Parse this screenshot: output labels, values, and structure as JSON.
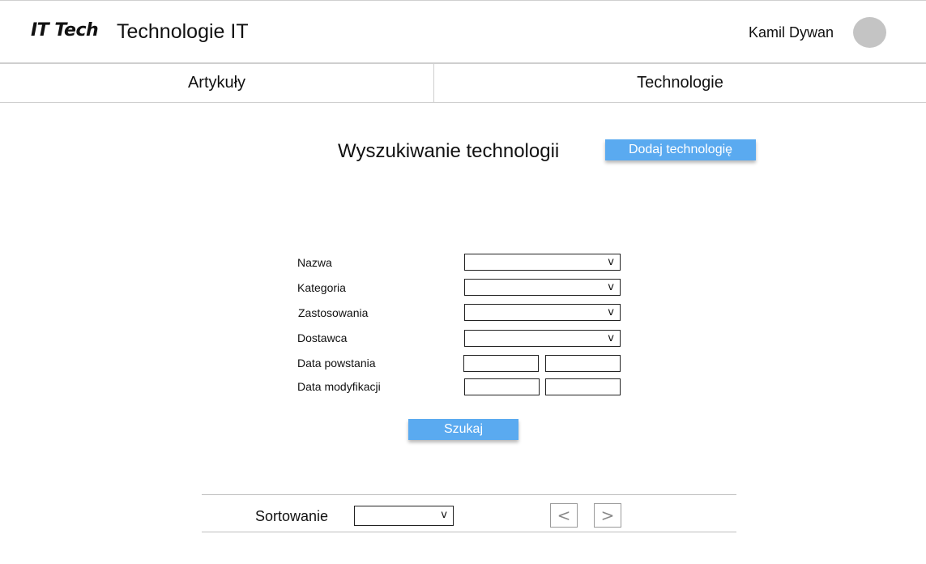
{
  "header": {
    "logo": "IT Tech",
    "title": "Technologie IT",
    "user_name": "Kamil Dywan"
  },
  "nav": {
    "tabs": [
      {
        "label": "Artykuły"
      },
      {
        "label": "Technologie"
      }
    ]
  },
  "page": {
    "title": "Wyszukiwanie technologii",
    "add_button": "Dodaj technologię"
  },
  "form": {
    "name_label": "Nazwa",
    "category_label": "Kategoria",
    "usage_label": "Zastosowania",
    "supplier_label": "Dostawca",
    "created_label": "Data powstania",
    "modified_label": "Data modyfikacji",
    "chevron": "v",
    "search_button": "Szukaj"
  },
  "sort": {
    "label": "Sortowanie",
    "chevron": "v"
  },
  "pager": {
    "prev": "<",
    "next": ">"
  },
  "colors": {
    "accent": "#5aaaf0",
    "avatar": "#c4c4c4"
  },
  "icons": {
    "avatar": "avatar-circle",
    "dropdown": "chevron-down-icon",
    "prev": "chevron-left-icon",
    "next": "chevron-right-icon"
  }
}
